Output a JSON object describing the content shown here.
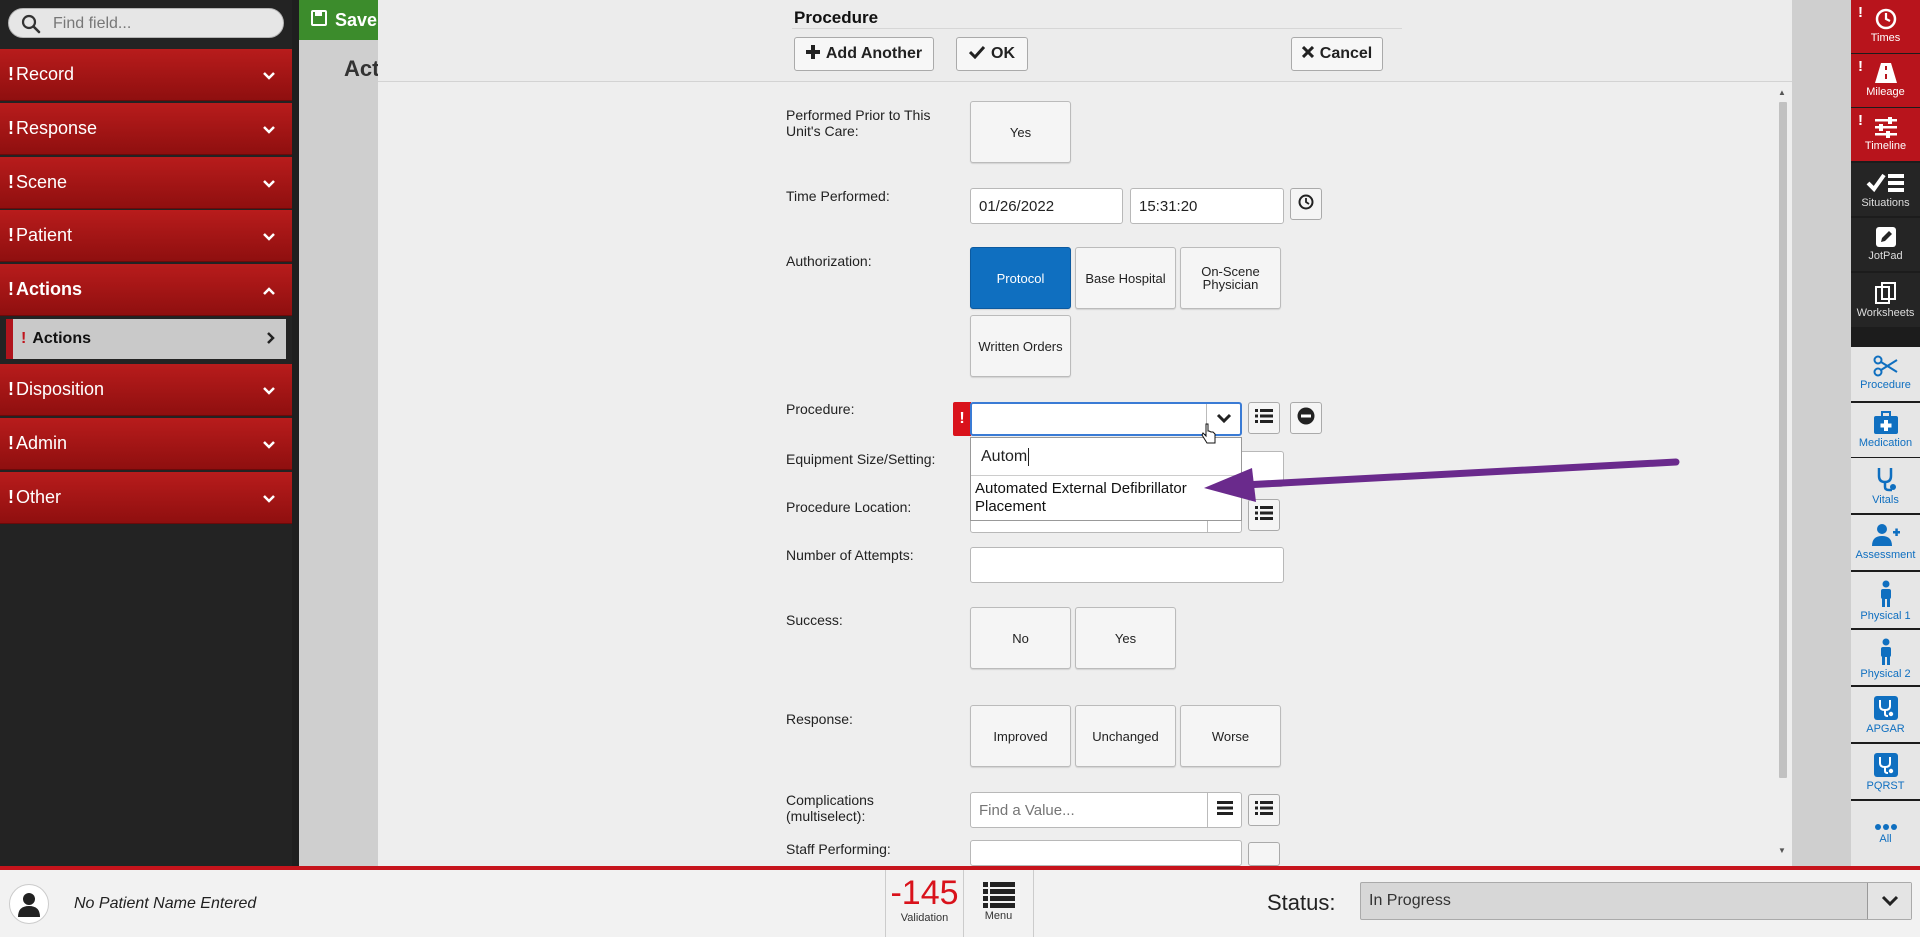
{
  "search": {
    "placeholder": "Find field..."
  },
  "sidebar": {
    "sections": [
      {
        "label": "Record",
        "flag": "!"
      },
      {
        "label": "Response",
        "flag": "!"
      },
      {
        "label": "Scene",
        "flag": "!"
      },
      {
        "label": "Patient",
        "flag": "!"
      },
      {
        "label": "Actions",
        "flag": "!"
      },
      {
        "label": "Disposition",
        "flag": "!"
      },
      {
        "label": "Admin",
        "flag": "!"
      },
      {
        "label": "Other",
        "flag": "!"
      }
    ],
    "sub_item": {
      "label": "Actions",
      "flag": "!"
    }
  },
  "background": {
    "save_label": "Save",
    "title_partial": "Act"
  },
  "modal": {
    "title": "Procedure",
    "buttons": {
      "add_another": "Add Another",
      "ok": "OK",
      "cancel": "Cancel"
    },
    "fields": {
      "prior_care": {
        "label": "Performed Prior to This Unit's Care:",
        "option": "Yes"
      },
      "time_performed": {
        "label": "Time Performed:",
        "date": "01/26/2022",
        "time": "15:31:20"
      },
      "authorization": {
        "label": "Authorization:",
        "options": [
          "Protocol",
          "Base Hospital",
          "On-Scene Physician",
          "Written Orders"
        ],
        "selected": "Protocol"
      },
      "procedure": {
        "label": "Procedure:",
        "flag": "!",
        "search_text": "Autom",
        "suggestion_line1": "Automated External Defibrillator",
        "suggestion_line2": "Placement"
      },
      "equipment": {
        "label": "Equipment Size/Setting:"
      },
      "location": {
        "label": "Procedure Location:"
      },
      "attempts": {
        "label": "Number of Attempts:"
      },
      "success": {
        "label": "Success:",
        "options": [
          "No",
          "Yes"
        ]
      },
      "response": {
        "label": "Response:",
        "options": [
          "Improved",
          "Unchanged",
          "Worse"
        ]
      },
      "complications": {
        "label": "Complications (multiselect):",
        "placeholder": "Find a Value..."
      },
      "staff": {
        "label": "Staff Performing:"
      }
    }
  },
  "right_toolbar": {
    "items": [
      {
        "label": "Times",
        "icon": "clock-icon",
        "flag": "!"
      },
      {
        "label": "Mileage",
        "icon": "road-icon",
        "flag": "!"
      },
      {
        "label": "Timeline",
        "icon": "sliders-icon",
        "flag": "!"
      },
      {
        "label": "Situations",
        "icon": "checklist-icon"
      },
      {
        "label": "JotPad",
        "icon": "pencil-icon"
      },
      {
        "label": "Worksheets",
        "icon": "copy-icon"
      },
      {
        "label": "Procedure",
        "icon": "scissors-icon"
      },
      {
        "label": "Medication",
        "icon": "medkit-icon"
      },
      {
        "label": "Vitals",
        "icon": "stethoscope-icon"
      },
      {
        "label": "Assessment",
        "icon": "user-plus-icon"
      },
      {
        "label": "Physical 1",
        "icon": "person-icon"
      },
      {
        "label": "Physical 2",
        "icon": "person-icon"
      },
      {
        "label": "APGAR",
        "icon": "stethoscope-icon"
      },
      {
        "label": "PQRST",
        "icon": "stethoscope-icon"
      },
      {
        "label": "All",
        "icon": "dots-icon"
      }
    ]
  },
  "bottom_bar": {
    "patient_name": "No Patient Name Entered",
    "validation_count": "-145",
    "validation_label": "Validation",
    "menu_label": "Menu",
    "status_label": "Status:",
    "status_value": "In Progress"
  },
  "colors": {
    "sidebar_red": "#b81c1c",
    "selected_blue": "#0f6fc0",
    "flag_red": "#d9121b",
    "annotation_arrow": "#6a2a8c",
    "save_green": "#3c8c2c"
  }
}
